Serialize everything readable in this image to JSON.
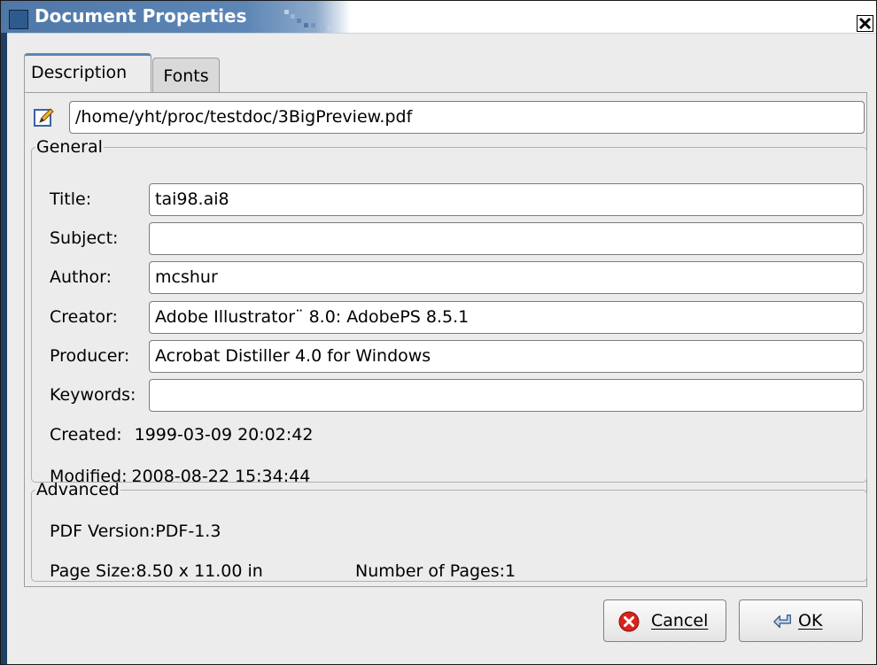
{
  "window": {
    "title": "Document Properties"
  },
  "tabs": [
    {
      "label": "Description"
    },
    {
      "label": "Fonts"
    }
  ],
  "file": {
    "path": "/home/yht/proc/testdoc/3BigPreview.pdf"
  },
  "general": {
    "legend": "General",
    "fields": [
      {
        "label": "Title:",
        "value": "tai98.ai8"
      },
      {
        "label": "Subject:",
        "value": ""
      },
      {
        "label": "Author:",
        "value": "mcshur"
      },
      {
        "label": "Creator:",
        "value": "Adobe Illustrator¨ 8.0: AdobePS 8.5.1"
      },
      {
        "label": "Producer:",
        "value": "Acrobat Distiller 4.0 for Windows"
      },
      {
        "label": "Keywords:",
        "value": ""
      }
    ],
    "created_label": "Created:",
    "created_value": "1999-03-09 20:02:42",
    "modified_label": "Modified:",
    "modified_value": "2008-08-22 15:34:44"
  },
  "advanced": {
    "legend": "Advanced",
    "pdf_version": "PDF Version:PDF-1.3",
    "page_size": "Page Size:8.50 x 11.00 in",
    "pages": "Number of Pages:1"
  },
  "buttons": {
    "cancel": "Cancel",
    "ok": "OK"
  },
  "icons": {
    "edit": "edit-pencil-icon",
    "cancel": "red-x-circle-icon",
    "ok": "enter-arrow-icon",
    "close": "close-x-icon"
  }
}
